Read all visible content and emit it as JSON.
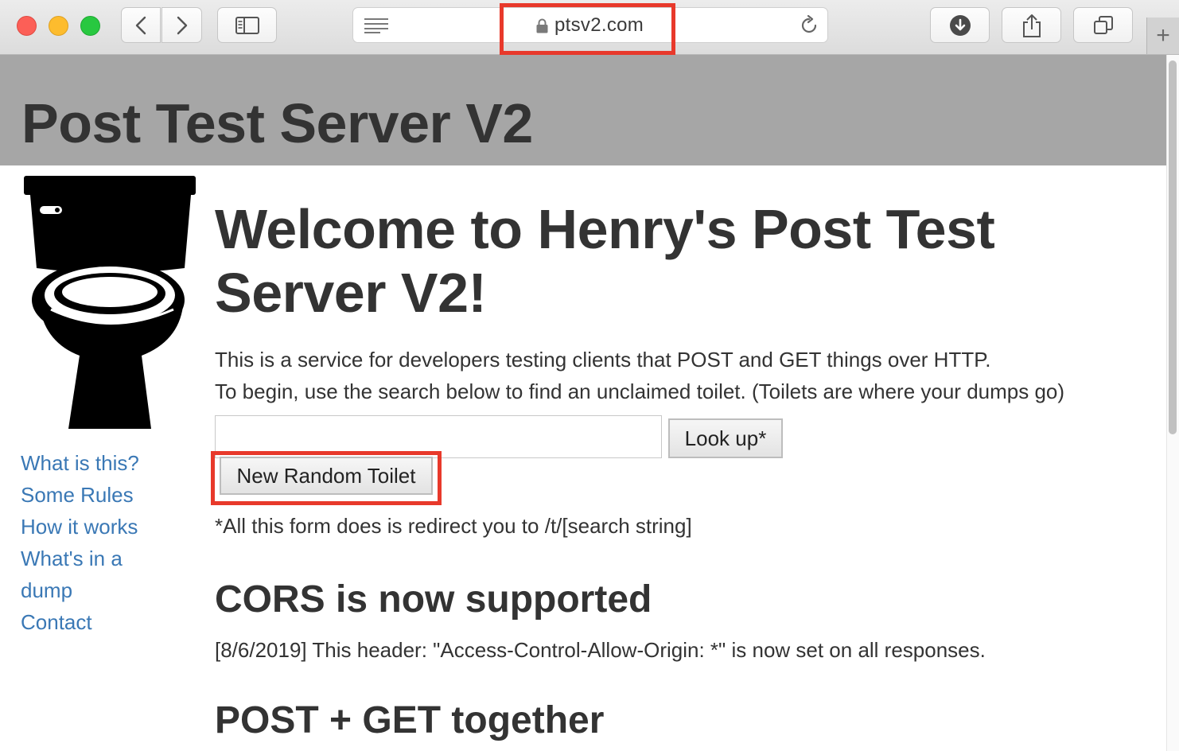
{
  "browser": {
    "url": "ptsv2.com",
    "new_tab_label": "+"
  },
  "site": {
    "title": "Post Test Server V2"
  },
  "nav": {
    "items": [
      {
        "label": "What is this?"
      },
      {
        "label": "Some Rules"
      },
      {
        "label": "How it works"
      },
      {
        "label": "What's in a"
      },
      {
        "label": "dump"
      },
      {
        "label": "Contact"
      }
    ]
  },
  "main": {
    "welcome_line1": "Welcome to Henry's Post Test",
    "welcome_line2": "Server V2!",
    "intro_line1": "This is a service for developers testing clients that POST and GET things over HTTP.",
    "intro_line2": "To begin, use the search below to find an unclaimed toilet. (Toilets are where your dumps go)",
    "search_value": "",
    "lookup_label": "Look up*",
    "random_label": "New Random Toilet",
    "form_note": "*All this form does is redirect you to /t/[search string]",
    "cors_title": "CORS is now supported",
    "cors_text": "[8/6/2019] This header: \"Access-Control-Allow-Origin: *\" is now set on all responses.",
    "postget_title": "POST + GET together"
  },
  "colors": {
    "link": "#3a78b5",
    "header_bg": "#a6a6a6",
    "highlight": "#e8392b"
  },
  "icons": [
    "back-arrow-icon",
    "forward-arrow-icon",
    "sidebar-icon",
    "reader-icon",
    "lock-icon",
    "reload-icon",
    "download-icon",
    "share-icon",
    "tabs-icon",
    "toilet-logo-icon"
  ]
}
